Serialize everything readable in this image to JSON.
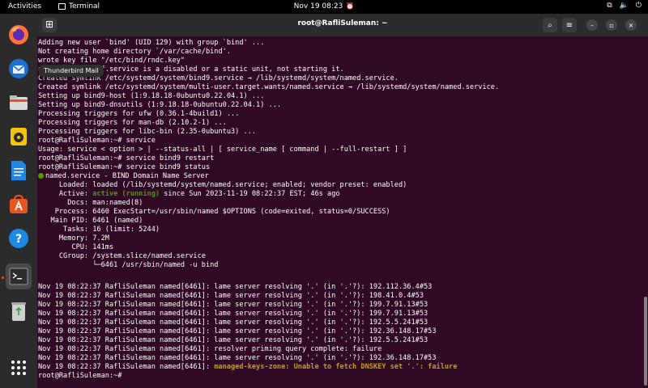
{
  "topbar": {
    "activities": "Activities",
    "app_name": "Terminal",
    "clock": "Nov 19  08:23"
  },
  "tooltip": "Thunderbird Mail",
  "dock": {
    "items": [
      "firefox",
      "thunderbird",
      "files",
      "rhythmbox",
      "libreoffice-writer",
      "app-center",
      "help",
      "terminal",
      "trash",
      "show-apps"
    ]
  },
  "window": {
    "title": "root@RafliSuleman: ~"
  },
  "terminal": {
    "lines": [
      "Adding new user `bind' (UID 129) with group `bind' ...",
      "Not creating home directory `/var/cache/bind'.",
      "wrote key file \"/etc/bind/rndc.key\"",
      "named-resolvconf.service is a disabled or a static unit, not starting it.",
      "Created symlink /etc/systemd/system/bind9.service → /lib/systemd/system/named.service.",
      "Created symlink /etc/systemd/system/multi-user.target.wants/named.service → /lib/systemd/system/named.service.",
      "Setting up bind9-host (1:9.18.18-0ubuntu0.22.04.1) ...",
      "Setting up bind9-dnsutils (1:9.18.18-0ubuntu0.22.04.1) ...",
      "Processing triggers for ufw (0.36.1-4build1) ...",
      "Processing triggers for man-db (2.10.2-1) ...",
      "Processing triggers for libc-bin (2.35-0ubuntu3) ...",
      "root@RafliSuleman:~# service",
      "Usage: service < option > | --status-all | [ service_name [ command | --full-restart ] ]",
      "root@RafliSuleman:~# service bind9 restart",
      "root@RafliSuleman:~# service bind9 status",
      "named.service - BIND Domain Name Server",
      "     Loaded: loaded (/lib/systemd/system/named.service; enabled; vendor preset: enabled)",
      "     Active: ",
      "active (running)",
      " since Sun 2023-11-19 08:22:37 EST; 46s ago",
      "       Docs: man:named(8)",
      "    Process: 6460 ExecStart=/usr/sbin/named $OPTIONS (code=exited, status=0/SUCCESS)",
      "   Main PID: 6461 (named)",
      "      Tasks: 16 (limit: 5244)",
      "     Memory: 7.2M",
      "        CPU: 141ms",
      "     CGroup: /system.slice/named.service",
      "             └─6461 /usr/sbin/named -u bind",
      "",
      "Nov 19 08:22:37 RafliSuleman named[6461]: lame server resolving '.' (in '.'?): 192.112.36.4#53",
      "Nov 19 08:22:37 RafliSuleman named[6461]: lame server resolving '.' (in '.'?): 198.41.0.4#53",
      "Nov 19 08:22:37 RafliSuleman named[6461]: lame server resolving '.' (in '.'?): 199.7.91.13#53",
      "Nov 19 08:22:37 RafliSuleman named[6461]: lame server resolving '.' (in '.'?): 199.7.91.13#53",
      "Nov 19 08:22:37 RafliSuleman named[6461]: lame server resolving '.' (in '.'?): 192.5.5.241#53",
      "Nov 19 08:22:37 RafliSuleman named[6461]: lame server resolving '.' (in '.'?): 192.36.148.17#53",
      "Nov 19 08:22:37 RafliSuleman named[6461]: lame server resolving '.' (in '.'?): 192.5.5.241#53",
      "Nov 19 08:22:37 RafliSuleman named[6461]: resolver priming query complete: failure",
      "Nov 19 08:22:37 RafliSuleman named[6461]: lame server resolving '.' (in '.'?): 192.36.148.17#53",
      "Nov 19 08:22:37 RafliSuleman named[6461]: ",
      "managed-keys-zone: Unable to fetch DNSKEY set '.': failure",
      "root@RafliSuleman:~# "
    ]
  },
  "colors": {
    "terminal_bg": "#300a24",
    "active_green": "#4e9a06",
    "warning_yellow": "#c4a000",
    "accent": "#e95420"
  }
}
